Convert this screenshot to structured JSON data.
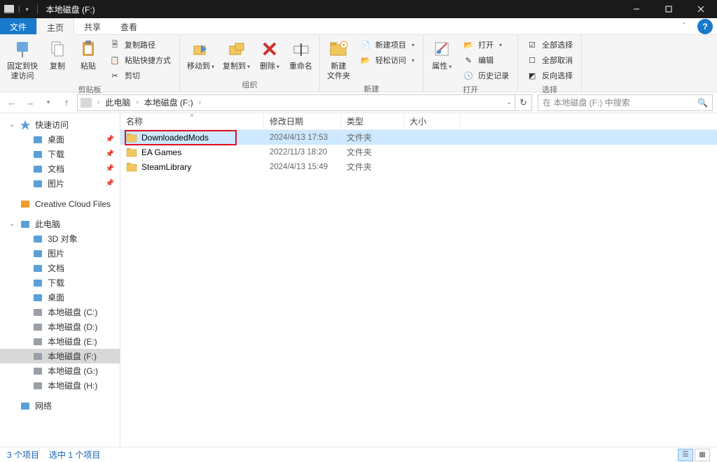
{
  "window": {
    "title": "本地磁盘 (F:)"
  },
  "tabs": {
    "file": "文件",
    "home": "主页",
    "share": "共享",
    "view": "查看"
  },
  "ribbon": {
    "clipboard": {
      "pin": "固定到快\n速访问",
      "copy": "复制",
      "paste": "粘贴",
      "copy_path": "复制路径",
      "paste_shortcut": "粘贴快捷方式",
      "cut": "剪切",
      "label": "剪贴板"
    },
    "organize": {
      "moveto": "移动到",
      "copyto": "复制到",
      "delete": "删除",
      "rename": "重命名",
      "label": "组织"
    },
    "new": {
      "newfolder": "新建\n文件夹",
      "newitem": "新建项目",
      "easyaccess": "轻松访问",
      "label": "新建"
    },
    "open": {
      "properties": "属性",
      "open": "打开",
      "edit": "编辑",
      "history": "历史记录",
      "label": "打开"
    },
    "select": {
      "all": "全部选择",
      "none": "全部取消",
      "invert": "反向选择",
      "label": "选择"
    }
  },
  "breadcrumb": {
    "pc": "此电脑",
    "drive": "本地磁盘 (F:)"
  },
  "search": {
    "placeholder": "在 本地磁盘 (F:) 中搜索"
  },
  "columns": {
    "name": "名称",
    "date": "修改日期",
    "type": "类型",
    "size": "大小"
  },
  "rows": [
    {
      "name": "DownloadedMods",
      "date": "2024/4/13 17:53",
      "type": "文件夹",
      "size": "",
      "selected": true,
      "highlight": true
    },
    {
      "name": "EA Games",
      "date": "2022/11/3 18:20",
      "type": "文件夹",
      "size": ""
    },
    {
      "name": "SteamLibrary",
      "date": "2024/4/13 15:49",
      "type": "文件夹",
      "size": ""
    }
  ],
  "sidebar": {
    "quick": {
      "label": "快速访问",
      "items": [
        {
          "label": "桌面",
          "icon": "desktop",
          "pin": true
        },
        {
          "label": "下载",
          "icon": "download",
          "pin": true
        },
        {
          "label": "文档",
          "icon": "document",
          "pin": true
        },
        {
          "label": "图片",
          "icon": "picture",
          "pin": true
        }
      ]
    },
    "ccf": "Creative Cloud Files",
    "pc": {
      "label": "此电脑",
      "items": [
        {
          "label": "3D 对象",
          "icon": "cube"
        },
        {
          "label": "图片",
          "icon": "picture"
        },
        {
          "label": "文档",
          "icon": "document"
        },
        {
          "label": "下载",
          "icon": "download"
        },
        {
          "label": "桌面",
          "icon": "desktop"
        },
        {
          "label": "本地磁盘 (C:)",
          "icon": "drive"
        },
        {
          "label": "本地磁盘 (D:)",
          "icon": "drive"
        },
        {
          "label": "本地磁盘 (E:)",
          "icon": "drive"
        },
        {
          "label": "本地磁盘 (F:)",
          "icon": "drive",
          "selected": true
        },
        {
          "label": "本地磁盘 (G:)",
          "icon": "drive"
        },
        {
          "label": "本地磁盘 (H:)",
          "icon": "drive"
        }
      ]
    },
    "network": "网络"
  },
  "status": {
    "count": "3 个项目",
    "selection": "选中 1 个项目"
  }
}
